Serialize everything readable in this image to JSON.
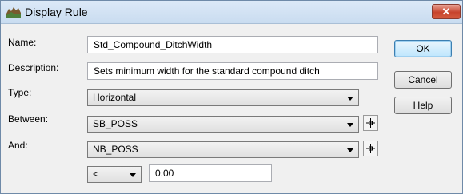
{
  "window": {
    "title": "Display Rule",
    "close_label": "✕"
  },
  "form": {
    "name_label": "Name:",
    "name_value": "Std_Compound_DitchWidth",
    "description_label": "Description:",
    "description_value": "Sets minimum width for the standard compound ditch",
    "type_label": "Type:",
    "type_value": "Horizontal",
    "between_label": "Between:",
    "between_value": "SB_POSS",
    "and_label": "And:",
    "and_value": "NB_POSS",
    "operator_value": "<",
    "amount_value": "0.00"
  },
  "buttons": {
    "ok_label": "OK",
    "cancel_label": "Cancel",
    "help_label": "Help"
  },
  "icons": {
    "app": "app-icon",
    "pick": "crosshair-pick-icon",
    "dropdown": "chevron-down-icon",
    "close": "close-icon"
  }
}
